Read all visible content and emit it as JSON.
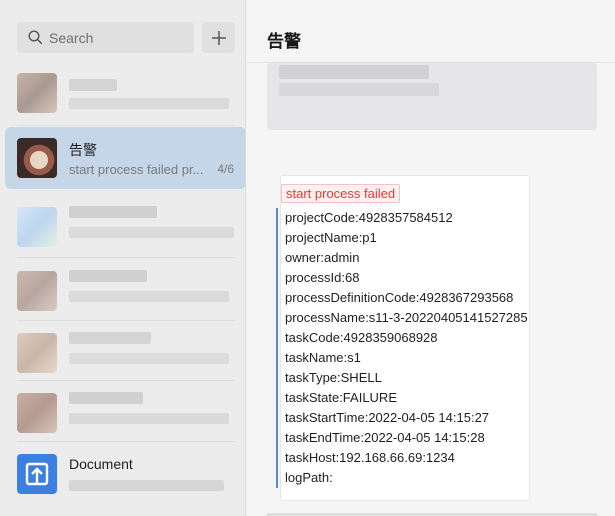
{
  "search": {
    "placeholder": "Search"
  },
  "chat_list": {
    "active": {
      "title": "告警",
      "preview": "start process failed pr...",
      "count": "4/6"
    },
    "document": {
      "title": "Document"
    }
  },
  "header": {
    "title": "告警"
  },
  "message": {
    "tag": "start process failed",
    "fields": [
      "projectCode:4928357584512",
      "projectName:p1",
      "owner:admin",
      "processId:68",
      "processDefinitionCode:4928367293568",
      "processName:s11-3-20220405141527285",
      "taskCode:4928359068928",
      "taskName:s1",
      "taskType:SHELL",
      "taskState:FAILURE",
      "taskStartTime:2022-04-05 14:15:27",
      "taskEndTime:2022-04-05 14:15:28",
      "taskHost:192.168.66.69:1234",
      "logPath:"
    ]
  },
  "colors": {
    "active_item": "#c6d6e9",
    "alert_tag": "#e03a3a",
    "quote_bar": "#5b8cc7",
    "doc_icon": "#3d7fe0"
  },
  "icons": {
    "search": "search-icon",
    "add": "plus-icon",
    "document": "document-icon"
  }
}
